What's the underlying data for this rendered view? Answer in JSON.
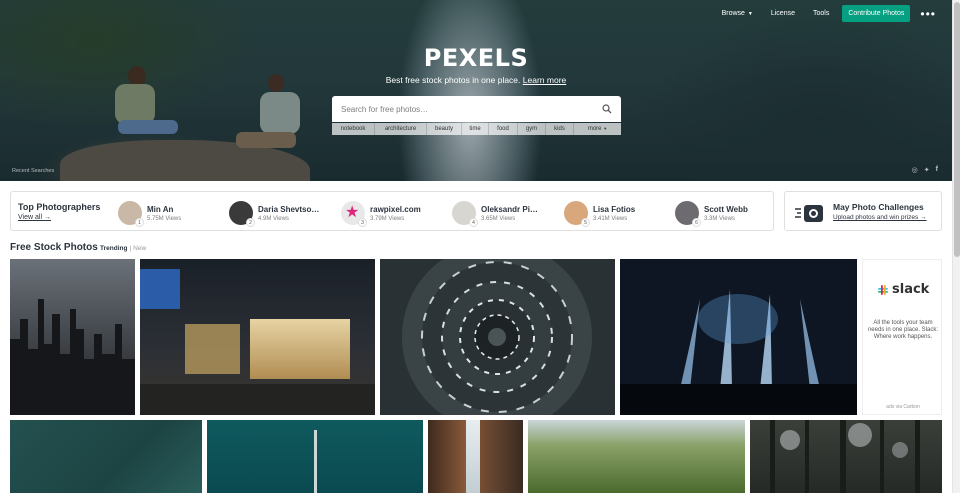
{
  "nav": {
    "browse": "Browse",
    "license": "License",
    "tools": "Tools",
    "contribute": "Contribute Photos",
    "more": "•••"
  },
  "hero": {
    "brand": "PEXELS",
    "tagline": "Best free stock photos in one place.",
    "learn_more": "Learn more",
    "search_placeholder": "Search for free photos…",
    "tags": [
      "notebook",
      "architecture",
      "beauty",
      "time",
      "food",
      "gym",
      "kids",
      "more"
    ],
    "recent": "Recent Searches"
  },
  "top_photographers": {
    "title": "Top Photographers",
    "view_all": "View all →",
    "items": [
      {
        "name": "Min An",
        "views": "5.75M Views",
        "rank": "1",
        "color": "#c9b8a6"
      },
      {
        "name": "Daria Shevtso…",
        "views": "4.9M Views",
        "rank": "2",
        "color": "#3a3a3a"
      },
      {
        "name": "rawpixel.com",
        "views": "3.79M Views",
        "rank": "3",
        "color": "#e8e8e8"
      },
      {
        "name": "Oleksandr Pi…",
        "views": "3.65M Views",
        "rank": "4",
        "color": "#d8d6d0"
      },
      {
        "name": "Lisa Fotios",
        "views": "3.41M Views",
        "rank": "5",
        "color": "#d9a77c"
      },
      {
        "name": "Scott Webb",
        "views": "3.3M Views",
        "rank": "6",
        "color": "#6d6b70"
      }
    ]
  },
  "challenge": {
    "title": "May Photo Challenges",
    "subtitle": "Upload photos and win prizes →"
  },
  "section": {
    "title": "Free Stock Photos",
    "tab_trending": "Trending",
    "separator": "|",
    "tab_new": "New"
  },
  "ad": {
    "brand": "slack",
    "text": "All the tools your team needs in one place. Slack: Where work happens.",
    "via": "ads via Carbon"
  },
  "colors": {
    "accent": "#05a081",
    "text": "#2c343e"
  }
}
